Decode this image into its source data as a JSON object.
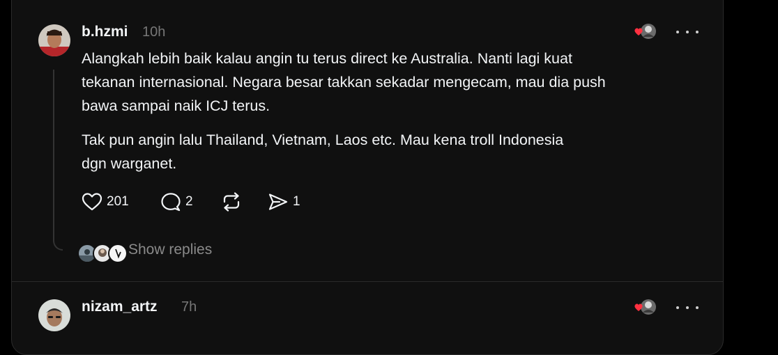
{
  "post1": {
    "username": "b.hzmi",
    "time": "10h",
    "paragraph1": "Alangkah lebih baik kalau angin tu terus direct ke Australia. Nanti lagi kuat\ntekanan internasional. Negara besar takkan sekadar mengecam, mau dia push\nbawa sampai naik ICJ terus.",
    "paragraph2": "Tak pun angin lalu Thailand, Vietnam, Laos etc. Mau kena troll Indonesia\ndgn warganet.",
    "like_count": "201",
    "reply_count": "2",
    "share_count": "1",
    "show_replies": "Show replies",
    "icons": [
      "heart-icon",
      "comment-icon",
      "repost-icon",
      "send-icon",
      "more-icon"
    ]
  },
  "post2": {
    "username": "nizam_artz",
    "time": "7h"
  },
  "colors": {
    "background": "#000000",
    "panel": "#101010",
    "text": "#f3f5f7",
    "muted": "#777777",
    "heart": "#ff3040"
  }
}
